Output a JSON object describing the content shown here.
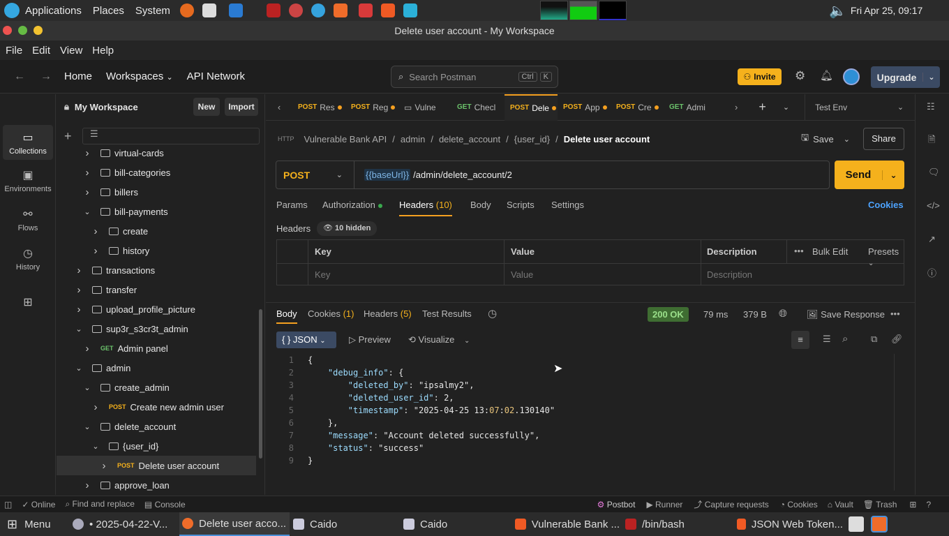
{
  "os_panel": {
    "menus": [
      "Applications",
      "Places",
      "System"
    ],
    "clock": "Fri Apr 25, 09:17"
  },
  "window": {
    "title": "Delete user account - My Workspace"
  },
  "menubar": [
    "File",
    "Edit",
    "View",
    "Help"
  ],
  "header": {
    "home": "Home",
    "workspaces": "Workspaces",
    "api_network": "API Network",
    "search_placeholder": "Search Postman",
    "search_kbd1": "Ctrl",
    "search_kbd2": "K",
    "invite": "Invite",
    "upgrade": "Upgrade"
  },
  "rail": [
    {
      "label": "Collections",
      "icon": "collections-icon"
    },
    {
      "label": "Environments",
      "icon": "environments-icon"
    },
    {
      "label": "Flows",
      "icon": "flows-icon"
    },
    {
      "label": "History",
      "icon": "history-icon"
    }
  ],
  "sidebar": {
    "workspace": "My Workspace",
    "new": "New",
    "import": "Import",
    "items": [
      {
        "label": "virtual-cards",
        "type": "folder",
        "depth": 2,
        "open": false
      },
      {
        "label": "bill-categories",
        "type": "folder",
        "depth": 2,
        "open": false
      },
      {
        "label": "billers",
        "type": "folder",
        "depth": 2,
        "open": false
      },
      {
        "label": "bill-payments",
        "type": "folder",
        "depth": 2,
        "open": true
      },
      {
        "label": "create",
        "type": "folder",
        "depth": 3,
        "open": false
      },
      {
        "label": "history",
        "type": "folder",
        "depth": 3,
        "open": false
      },
      {
        "label": "transactions",
        "type": "folder",
        "depth": 1,
        "open": false
      },
      {
        "label": "transfer",
        "type": "folder",
        "depth": 1,
        "open": false
      },
      {
        "label": "upload_profile_picture",
        "type": "folder",
        "depth": 1,
        "open": false
      },
      {
        "label": "sup3r_s3cr3t_admin",
        "type": "folder",
        "depth": 1,
        "open": true
      },
      {
        "label": "Admin panel",
        "type": "request",
        "method": "GET",
        "depth": 2
      },
      {
        "label": "admin",
        "type": "folder",
        "depth": 1,
        "open": true
      },
      {
        "label": "create_admin",
        "type": "folder",
        "depth": 2,
        "open": true
      },
      {
        "label": "Create new admin user",
        "type": "request",
        "method": "POST",
        "depth": 3
      },
      {
        "label": "delete_account",
        "type": "folder",
        "depth": 2,
        "open": true
      },
      {
        "label": "{user_id}",
        "type": "folder",
        "depth": 3,
        "open": true
      },
      {
        "label": "Delete user account",
        "type": "request",
        "method": "POST",
        "depth": 4,
        "selected": true
      },
      {
        "label": "approve_loan",
        "type": "folder",
        "depth": 2,
        "open": false
      }
    ]
  },
  "tabs": [
    {
      "method": "POST",
      "name": "Res",
      "dot": true
    },
    {
      "method": "POST",
      "name": "Reg",
      "dot": true
    },
    {
      "method": "",
      "name": "Vulne",
      "dot": false
    },
    {
      "method": "GET",
      "name": "Checl",
      "dot": false
    },
    {
      "method": "POST",
      "name": "Dele",
      "dot": true,
      "active": true
    },
    {
      "method": "POST",
      "name": "App",
      "dot": true
    },
    {
      "method": "POST",
      "name": "Cre",
      "dot": true
    },
    {
      "method": "GET",
      "name": "Admi",
      "dot": false
    }
  ],
  "environment": "Test Env",
  "breadcrumb": [
    "Vulnerable Bank API",
    "admin",
    "delete_account",
    "{user_id}",
    "Delete user account"
  ],
  "actions": {
    "save": "Save",
    "share": "Share"
  },
  "request": {
    "method": "POST",
    "url_var": "{{baseUrl}}",
    "url_path": "/admin/delete_account/2",
    "send": "Send"
  },
  "request_tabs": {
    "params": "Params",
    "authorization": "Authorization",
    "headers": "Headers",
    "headers_count": "(10)",
    "body": "Body",
    "scripts": "Scripts",
    "settings": "Settings",
    "cookies": "Cookies"
  },
  "headers_section": {
    "title": "Headers",
    "hidden": "10 hidden",
    "col_key": "Key",
    "col_value": "Value",
    "col_desc": "Description",
    "bulk_edit": "Bulk Edit",
    "presets": "Presets",
    "ph_key": "Key",
    "ph_value": "Value",
    "ph_desc": "Description"
  },
  "response": {
    "tabs": [
      "Body",
      "Cookies",
      "Headers",
      "Test Results"
    ],
    "cookies_count": "(1)",
    "headers_count": "(5)",
    "status": "200 OK",
    "time": "79 ms",
    "size": "379 B",
    "save_response": "Save Response",
    "format": "JSON",
    "preview": "Preview",
    "visualize": "Visualize",
    "body_lines": [
      "{",
      "    \"debug_info\": {",
      "        \"deleted_by\": \"ipsalmy2\",",
      "        \"deleted_user_id\": 2,",
      "        \"timestamp\": \"2025-04-25 13:07:02.130140\"",
      "    },",
      "    \"message\": \"Account deleted successfully\",",
      "    \"status\": \"success\"",
      "}"
    ]
  },
  "statusbar": {
    "online": "Online",
    "find": "Find and replace",
    "console": "Console",
    "postbot": "Postbot",
    "runner": "Runner",
    "capture": "Capture requests",
    "cookies": "Cookies",
    "vault": "Vault",
    "trash": "Trash"
  },
  "taskbar": {
    "menu": "Menu",
    "items": [
      "• 2025-04-22-V...",
      "Delete user acco...",
      "Caido",
      "Caido",
      "Vulnerable Bank ...",
      "/bin/bash",
      "JSON Web Token..."
    ]
  },
  "colors": {
    "accent": "#f5b11c",
    "post": "#f5b11c",
    "get": "#6bc26b",
    "status_ok": "#3f6d32"
  }
}
